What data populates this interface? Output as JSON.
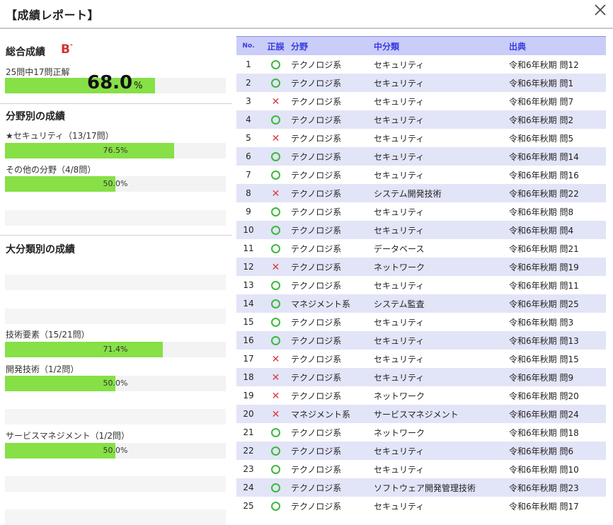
{
  "header": {
    "title": "【成績レポート】"
  },
  "overall": {
    "heading": "総合成績",
    "grade": "B",
    "grade_mark": "-",
    "summary": "25問中17問正解",
    "percent": "68.0",
    "percent_unit": "%",
    "ratio": 0.68
  },
  "by_field": {
    "heading": "分野別の成績",
    "items": [
      {
        "label": "★セキュリティ（13/17問）",
        "percent": "76.5%",
        "ratio": 0.765
      },
      {
        "label": "その他の分野（4/8問）",
        "percent": "50.0%",
        "ratio": 0.5
      }
    ]
  },
  "by_category": {
    "heading": "大分類別の成績",
    "items": [
      {
        "label": "技術要素（15/21問）",
        "percent": "71.4%",
        "ratio": 0.714
      },
      {
        "label": "開発技術（1/2問）",
        "percent": "50.0%",
        "ratio": 0.5
      },
      {
        "label": "サービスマネジメント（1/2問）",
        "percent": "50.0%",
        "ratio": 0.5
      }
    ]
  },
  "table": {
    "headers": {
      "no": "No.",
      "result": "正誤",
      "field": "分野",
      "category": "中分類",
      "source": "出典"
    },
    "rows": [
      {
        "no": "1",
        "result": "correct",
        "field": "テクノロジ系",
        "category": "セキュリティ",
        "source": "令和6年秋期 問12"
      },
      {
        "no": "2",
        "result": "correct",
        "field": "テクノロジ系",
        "category": "セキュリティ",
        "source": "令和6年秋期 問1"
      },
      {
        "no": "3",
        "result": "wrong",
        "field": "テクノロジ系",
        "category": "セキュリティ",
        "source": "令和6年秋期 問7"
      },
      {
        "no": "4",
        "result": "correct",
        "field": "テクノロジ系",
        "category": "セキュリティ",
        "source": "令和6年秋期 問2"
      },
      {
        "no": "5",
        "result": "wrong",
        "field": "テクノロジ系",
        "category": "セキュリティ",
        "source": "令和6年秋期 問5"
      },
      {
        "no": "6",
        "result": "correct",
        "field": "テクノロジ系",
        "category": "セキュリティ",
        "source": "令和6年秋期 問14"
      },
      {
        "no": "7",
        "result": "correct",
        "field": "テクノロジ系",
        "category": "セキュリティ",
        "source": "令和6年秋期 問16"
      },
      {
        "no": "8",
        "result": "wrong",
        "field": "テクノロジ系",
        "category": "システム開発技術",
        "source": "令和6年秋期 問22"
      },
      {
        "no": "9",
        "result": "correct",
        "field": "テクノロジ系",
        "category": "セキュリティ",
        "source": "令和6年秋期 問8"
      },
      {
        "no": "10",
        "result": "correct",
        "field": "テクノロジ系",
        "category": "セキュリティ",
        "source": "令和6年秋期 問4"
      },
      {
        "no": "11",
        "result": "correct",
        "field": "テクノロジ系",
        "category": "データベース",
        "source": "令和6年秋期 問21"
      },
      {
        "no": "12",
        "result": "wrong",
        "field": "テクノロジ系",
        "category": "ネットワーク",
        "source": "令和6年秋期 問19"
      },
      {
        "no": "13",
        "result": "correct",
        "field": "テクノロジ系",
        "category": "セキュリティ",
        "source": "令和6年秋期 問11"
      },
      {
        "no": "14",
        "result": "correct",
        "field": "マネジメント系",
        "category": "システム監査",
        "source": "令和6年秋期 問25"
      },
      {
        "no": "15",
        "result": "correct",
        "field": "テクノロジ系",
        "category": "セキュリティ",
        "source": "令和6年秋期 問3"
      },
      {
        "no": "16",
        "result": "correct",
        "field": "テクノロジ系",
        "category": "セキュリティ",
        "source": "令和6年秋期 問13"
      },
      {
        "no": "17",
        "result": "wrong",
        "field": "テクノロジ系",
        "category": "セキュリティ",
        "source": "令和6年秋期 問15"
      },
      {
        "no": "18",
        "result": "wrong",
        "field": "テクノロジ系",
        "category": "セキュリティ",
        "source": "令和6年秋期 問9"
      },
      {
        "no": "19",
        "result": "wrong",
        "field": "テクノロジ系",
        "category": "ネットワーク",
        "source": "令和6年秋期 問20"
      },
      {
        "no": "20",
        "result": "wrong",
        "field": "マネジメント系",
        "category": "サービスマネジメント",
        "source": "令和6年秋期 問24"
      },
      {
        "no": "21",
        "result": "correct",
        "field": "テクノロジ系",
        "category": "ネットワーク",
        "source": "令和6年秋期 問18"
      },
      {
        "no": "22",
        "result": "correct",
        "field": "テクノロジ系",
        "category": "セキュリティ",
        "source": "令和6年秋期 問6"
      },
      {
        "no": "23",
        "result": "correct",
        "field": "テクノロジ系",
        "category": "セキュリティ",
        "source": "令和6年秋期 問10"
      },
      {
        "no": "24",
        "result": "correct",
        "field": "テクノロジ系",
        "category": "ソフトウェア開発管理技術",
        "source": "令和6年秋期 問23"
      },
      {
        "no": "25",
        "result": "correct",
        "field": "テクノロジ系",
        "category": "セキュリティ",
        "source": "令和6年秋期 問17"
      }
    ]
  },
  "icons": {
    "close": "close-icon",
    "correct": "circle-icon",
    "wrong": "cross-icon"
  },
  "colors": {
    "bar": "#86e046",
    "header_bg": "#c9cdf7",
    "header_text": "#3a3ae0",
    "grade": "#d63030",
    "correct": "#3cb93c",
    "wrong": "#e0373b",
    "alt_row": "#e2e4f7"
  }
}
